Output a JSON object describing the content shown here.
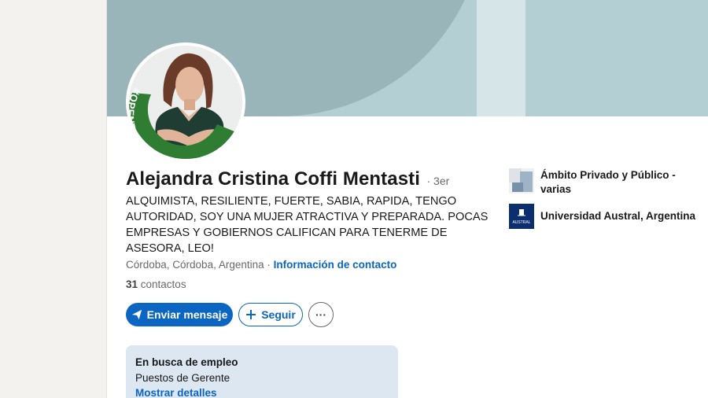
{
  "profile": {
    "name": "Alejandra Cristina Coffi Mentasti",
    "degree": "· 3er",
    "headline": "ALQUIMISTA, RESILIENTE, FUERTE, SABIA, RAPIDA, TENGO AUTORIDAD, SOY UNA MUJER ATRACTIVA Y PREPARADA. POCAS EMPRESAS Y GOBIERNOS CALIFICAN PARA TENERME DE ASESORA, LEO!",
    "location": "Córdoba, Córdoba, Argentina",
    "contact_sep": " · ",
    "contact_link": "Información de contacto",
    "connections_count": "31",
    "connections_label": " contactos",
    "open_to_work_badge": "#OPENTOWORK"
  },
  "actions": {
    "message_label": "Enviar mensaje",
    "follow_label": "Seguir",
    "more_label": "···"
  },
  "open_to_work": {
    "title": "En busca de empleo",
    "roles": "Puestos de Gerente",
    "details_link": "Mostrar detalles"
  },
  "experience": [
    {
      "name": "Ámbito Privado y Público -\nvarias"
    },
    {
      "name": "Universidad Austral, Argentina",
      "logo_text": "AUSTRAL"
    }
  ],
  "colors": {
    "accent": "#0a66c2",
    "otw_green": "#2e7d32",
    "banner": "#b4cfd3",
    "banner_dark": "#9ab5b9",
    "austral_blue": "#0b2f6e"
  }
}
